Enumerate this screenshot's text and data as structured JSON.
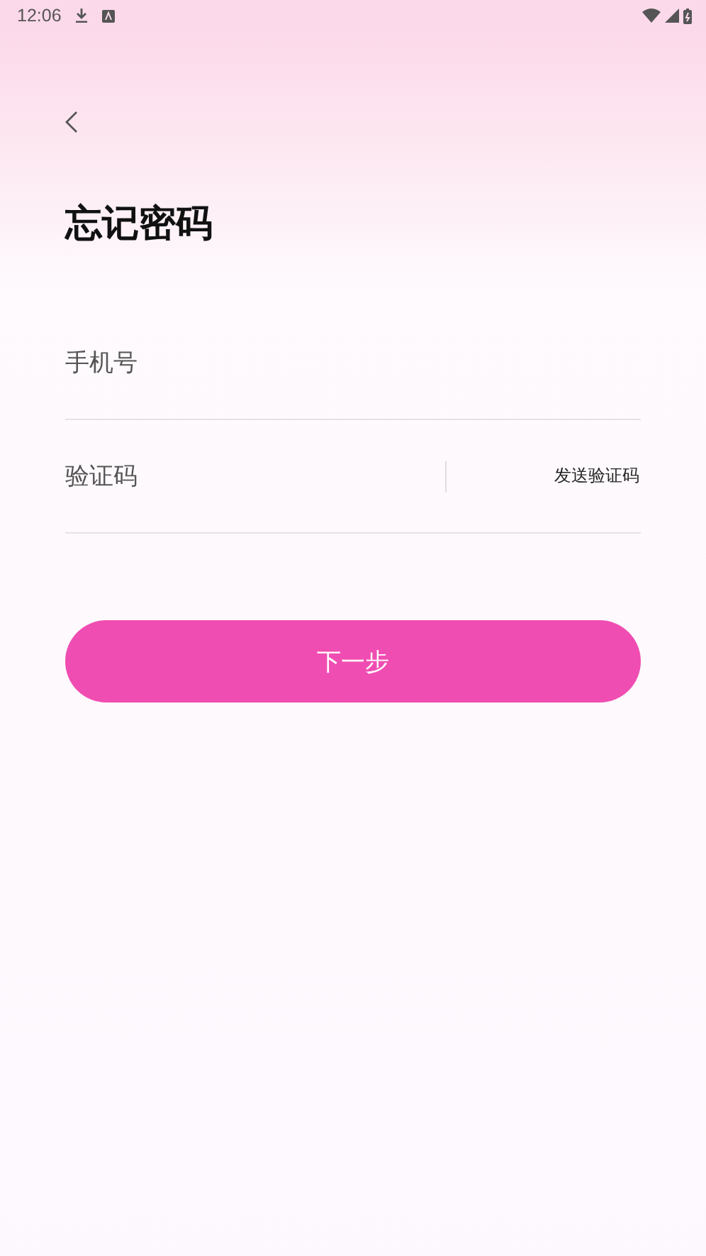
{
  "status_bar": {
    "time": "12:06"
  },
  "title": "忘记密码",
  "fields": [
    {
      "placeholder": "手机号",
      "kind": "plain"
    },
    {
      "placeholder": "验证码",
      "kind": "code",
      "action": "发送验证码"
    }
  ],
  "submit": "下一步"
}
